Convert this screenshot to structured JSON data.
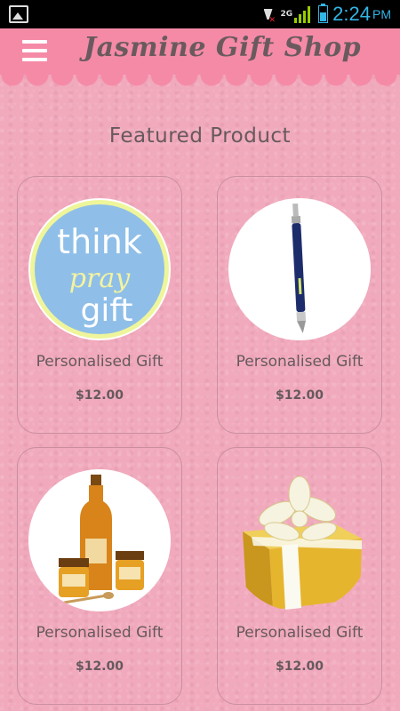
{
  "status_bar": {
    "time": "2:24",
    "ampm": "PM",
    "network_label": "2G",
    "icons": [
      "image-notification-icon",
      "wifi-off-icon",
      "signal-icon",
      "battery-icon"
    ]
  },
  "header": {
    "title": "Jasmine Gift Shop",
    "menu_icon": "hamburger-menu-icon"
  },
  "section": {
    "title": "Featured Product"
  },
  "products": [
    {
      "name": "Personalised Gift",
      "price": "$12.00",
      "image": "think-pray-gift-logo",
      "logo_words": [
        "think",
        "pray",
        "gift"
      ]
    },
    {
      "name": "Personalised Gift",
      "price": "$12.00",
      "image": "blue-pen"
    },
    {
      "name": "Personalised Gift",
      "price": "$12.00",
      "image": "honey-jars"
    },
    {
      "name": "Personalised Gift",
      "price": "$12.00",
      "image": "gold-gift-box"
    }
  ],
  "colors": {
    "background": "#f1a9bc",
    "header": "#f58aa7",
    "text": "#66595d",
    "status_accent": "#33b5e5"
  }
}
